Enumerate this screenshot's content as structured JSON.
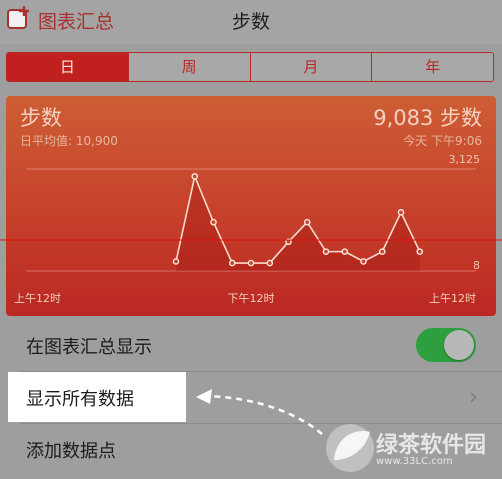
{
  "nav": {
    "back_label": "图表汇总",
    "title": "步数"
  },
  "segments": [
    {
      "label": "日",
      "active": true
    },
    {
      "label": "周",
      "active": false
    },
    {
      "label": "月",
      "active": false
    },
    {
      "label": "年",
      "active": false
    }
  ],
  "card": {
    "title": "步数",
    "daily_avg_label": "日平均值: 10,900",
    "value": "9,083 步数",
    "timestamp": "今天 下午9:06"
  },
  "chart_data": {
    "type": "line",
    "ylim": [
      8,
      3125
    ],
    "y_ticks": [
      "3,125",
      "8"
    ],
    "x_ticks": [
      "上午12时",
      "下午12时",
      "上午12时"
    ],
    "x": [
      8,
      9,
      10,
      11,
      12,
      13,
      14,
      15,
      16,
      17,
      18,
      19,
      20,
      21
    ],
    "values": [
      300,
      2900,
      1500,
      250,
      250,
      250,
      900,
      1500,
      600,
      600,
      300,
      600,
      1800,
      600
    ]
  },
  "rows": {
    "show_in_dashboard": "在图表汇总显示",
    "show_all_data": "显示所有数据",
    "add_data_point": "添加数据点"
  },
  "toggle_on": true,
  "watermark": {
    "text": "绿茶软件园",
    "url": "www.33LC.com"
  },
  "colors": {
    "accent": "#c0211f",
    "toggle": "#2e9f3e",
    "card_top": "#cd5e34",
    "card_bottom": "#bb2822"
  }
}
